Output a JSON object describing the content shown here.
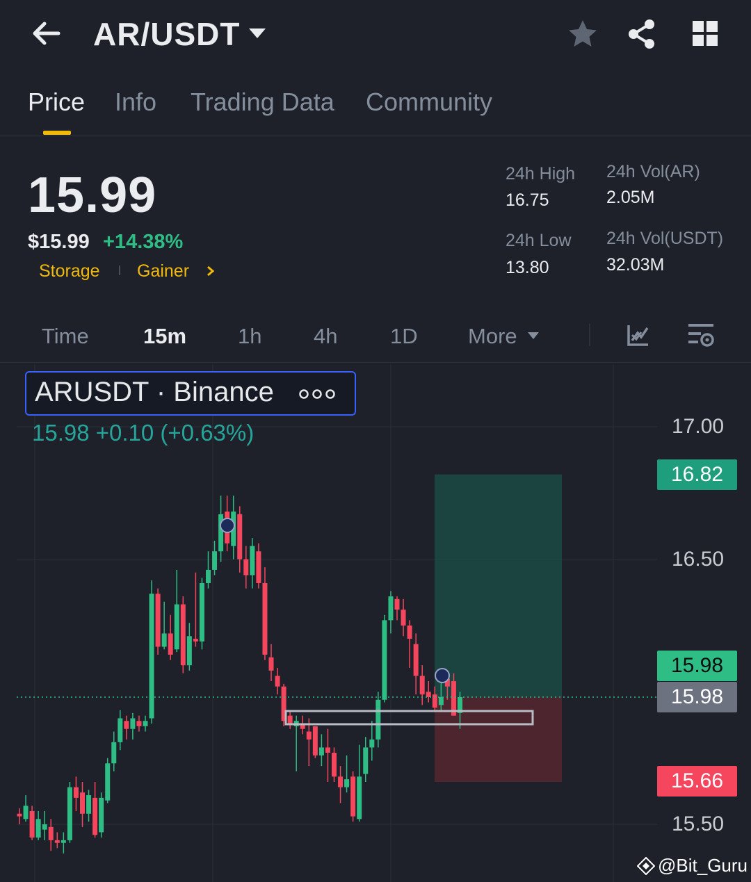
{
  "header": {
    "title": "AR/USDT",
    "icons": [
      "back-arrow-icon",
      "caret-down-icon",
      "star-icon",
      "share-icon",
      "grid-icon"
    ]
  },
  "tabs": [
    {
      "label": "Price",
      "active": true
    },
    {
      "label": "Info"
    },
    {
      "label": "Trading Data"
    },
    {
      "label": "Community"
    }
  ],
  "price": {
    "last": "15.99",
    "usd": "$15.99",
    "change": "+14.38%",
    "tags": [
      "Storage",
      "Gainer"
    ]
  },
  "stats": {
    "high_label": "24h High",
    "high": "16.75",
    "low_label": "24h Low",
    "low": "13.80",
    "vol_base_label": "24h Vol(AR)",
    "vol_base": "2.05M",
    "vol_quote_label": "24h Vol(USDT)",
    "vol_quote": "32.03M"
  },
  "intervals": {
    "items": [
      "Time",
      "15m",
      "1h",
      "4h",
      "1D",
      "More"
    ],
    "active": "15m"
  },
  "chart": {
    "symbol": "ARUSDT · Binance",
    "ohlc": "15.98  +0.10 (+0.63%)",
    "axis_labels": [
      "17.00",
      "16.50",
      "15.50"
    ],
    "tp_price": "16.82",
    "last_price_a": "15.98",
    "last_price_b": "15.98",
    "sl_price": "15.66"
  },
  "colors": {
    "up": "#2ebd85",
    "down": "#f6465d",
    "accent": "#f0b90b",
    "background": "#1e2129"
  },
  "watermark": "@Bit_Guru",
  "chart_data": {
    "type": "candlestick",
    "y_range": [
      15.44,
      17.08
    ],
    "axis_ticks": [
      17.0,
      16.5,
      15.5
    ],
    "candles": [
      [
        15.54,
        15.53,
        15.56,
        15.5
      ],
      [
        15.52,
        15.57,
        15.61,
        15.51
      ],
      [
        15.55,
        15.45,
        15.57,
        15.44
      ],
      [
        15.45,
        15.52,
        15.55,
        15.44
      ],
      [
        15.48,
        15.5,
        15.55,
        15.44
      ],
      [
        15.49,
        15.44,
        15.52,
        15.4
      ],
      [
        15.44,
        15.43,
        15.47,
        15.41
      ],
      [
        15.43,
        15.44,
        15.47,
        15.39
      ],
      [
        15.44,
        15.64,
        15.66,
        15.43
      ],
      [
        15.64,
        15.6,
        15.68,
        15.55
      ],
      [
        15.62,
        15.54,
        15.66,
        15.49
      ],
      [
        15.54,
        15.61,
        15.63,
        15.51
      ],
      [
        15.6,
        15.46,
        15.66,
        15.45
      ],
      [
        15.47,
        15.6,
        15.62,
        15.45
      ],
      [
        15.59,
        15.73,
        15.75,
        15.58
      ],
      [
        15.73,
        15.81,
        15.85,
        15.7
      ],
      [
        15.81,
        15.9,
        15.93,
        15.78
      ],
      [
        15.89,
        15.86,
        15.91,
        15.82
      ],
      [
        15.86,
        15.9,
        15.92,
        15.82
      ],
      [
        15.89,
        15.87,
        15.91,
        15.85
      ],
      [
        15.87,
        15.89,
        15.91,
        15.85
      ],
      [
        15.9,
        16.37,
        16.42,
        15.88
      ],
      [
        16.37,
        16.17,
        16.39,
        16.14
      ],
      [
        16.17,
        16.22,
        16.34,
        16.16
      ],
      [
        16.22,
        16.14,
        16.29,
        16.12
      ],
      [
        16.16,
        16.33,
        16.46,
        16.15
      ],
      [
        16.33,
        16.1,
        16.36,
        16.07
      ],
      [
        16.1,
        16.21,
        16.26,
        16.08
      ],
      [
        16.2,
        16.19,
        16.45,
        16.17
      ],
      [
        16.19,
        16.41,
        16.43,
        16.16
      ],
      [
        16.41,
        16.46,
        16.53,
        16.39
      ],
      [
        16.46,
        16.53,
        16.57,
        16.44
      ],
      [
        16.53,
        16.67,
        16.74,
        16.49
      ],
      [
        16.68,
        16.56,
        16.74,
        16.53
      ],
      [
        16.55,
        16.68,
        16.74,
        16.5
      ],
      [
        16.67,
        16.5,
        16.7,
        16.45
      ],
      [
        16.5,
        16.44,
        16.55,
        16.39
      ],
      [
        16.44,
        16.55,
        16.58,
        16.39
      ],
      [
        16.53,
        16.41,
        16.56,
        16.39
      ],
      [
        16.41,
        16.14,
        16.47,
        16.12
      ],
      [
        16.13,
        16.08,
        16.18,
        16.04
      ],
      [
        16.06,
        16.02,
        16.09,
        15.99
      ],
      [
        16.02,
        15.89,
        16.03,
        15.87
      ],
      [
        15.91,
        15.88,
        15.93,
        15.86
      ],
      [
        15.87,
        15.89,
        15.91,
        15.7
      ],
      [
        15.88,
        15.86,
        15.91,
        15.84
      ],
      [
        15.85,
        15.82,
        15.9,
        15.72
      ],
      [
        15.87,
        15.76,
        15.87,
        15.75
      ],
      [
        15.76,
        15.79,
        15.84,
        15.72
      ],
      [
        15.79,
        15.77,
        15.86,
        15.66
      ],
      [
        15.77,
        15.68,
        15.79,
        15.66
      ],
      [
        15.68,
        15.64,
        15.72,
        15.58
      ],
      [
        15.64,
        15.67,
        15.76,
        15.62
      ],
      [
        15.68,
        15.53,
        15.7,
        15.51
      ],
      [
        15.52,
        15.68,
        15.8,
        15.51
      ],
      [
        15.69,
        15.79,
        15.83,
        15.66
      ],
      [
        15.79,
        15.82,
        15.89,
        15.74
      ],
      [
        15.82,
        15.97,
        16.0,
        15.79
      ],
      [
        15.97,
        16.27,
        16.29,
        15.96
      ],
      [
        16.27,
        16.36,
        16.38,
        16.22
      ],
      [
        16.35,
        16.31,
        16.36,
        16.27
      ],
      [
        16.31,
        16.25,
        16.35,
        16.21
      ],
      [
        16.25,
        16.2,
        16.27,
        16.09
      ],
      [
        16.18,
        16.06,
        16.22,
        15.99
      ],
      [
        16.06,
        15.99,
        16.1,
        15.95
      ],
      [
        16.0,
        15.98,
        16.04,
        15.96
      ],
      [
        15.99,
        15.94,
        16.02,
        15.93
      ],
      [
        15.95,
        15.98,
        16.08,
        15.93
      ],
      [
        16.05,
        16.02,
        16.08,
        15.97
      ],
      [
        16.04,
        15.91,
        16.07,
        15.91
      ],
      [
        15.92,
        15.98,
        16.0,
        15.86
      ]
    ],
    "take_profit": 16.82,
    "entry": 15.98,
    "stop_loss": 15.66
  }
}
